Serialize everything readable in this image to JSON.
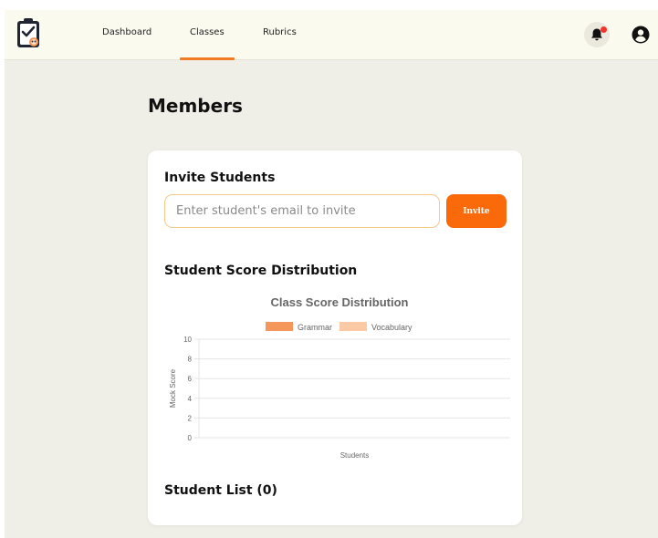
{
  "nav": {
    "links": [
      "Dashboard",
      "Classes",
      "Rubrics"
    ],
    "active": "Classes",
    "accent": "#f07a22"
  },
  "icons": {
    "logo": "clipboard-check-logo",
    "notifications": "bell-icon",
    "profile": "user-circle-icon"
  },
  "page": {
    "title": "Members"
  },
  "invite": {
    "title": "Invite Students",
    "placeholder": "Enter student's email to invite",
    "button_label": "Invite",
    "button_color": "#fa6a0a"
  },
  "distribution": {
    "title": "Student Score Distribution"
  },
  "chart_data": {
    "type": "bar",
    "title": "Class Score Distribution",
    "xlabel": "Students",
    "ylabel": "Mock Score",
    "categories": [],
    "series": [
      {
        "name": "Grammar",
        "values": [],
        "color": "#f5965a"
      },
      {
        "name": "Vocabulary",
        "values": [],
        "color": "#fbc9a3"
      }
    ],
    "ylim": [
      0,
      10
    ],
    "yticks": [
      0,
      2,
      4,
      6,
      8,
      10
    ],
    "grid": true,
    "legend": "top"
  },
  "student_list": {
    "title": "Student List (0)"
  }
}
